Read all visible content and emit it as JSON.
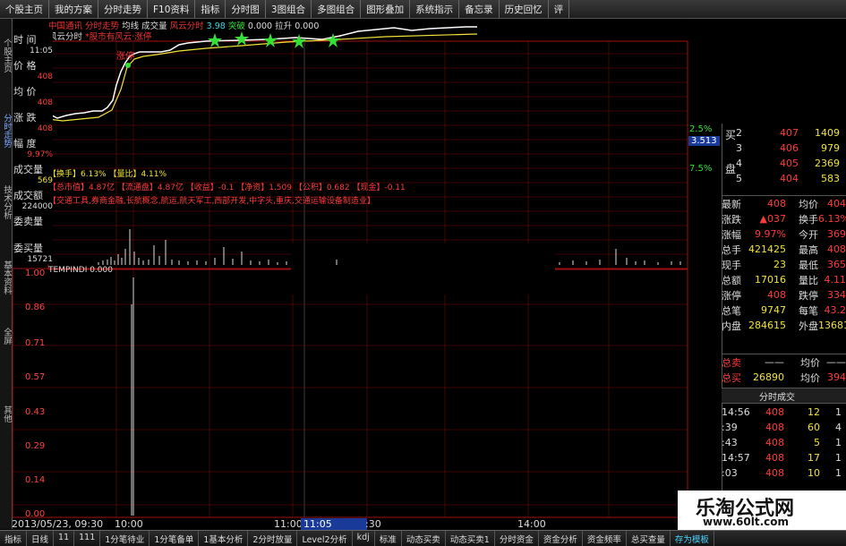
{
  "topbar": [
    "个股主页",
    "我的方案",
    "分时走势",
    "F10资料",
    "指标",
    "分时图",
    "3图组合",
    "多图组合",
    "图形叠加",
    "系统指示",
    "备忘录",
    "历史回忆",
    "评"
  ],
  "header": {
    "line1_a": "中国通讯 分时走势",
    "line1_b": "均线 成交量",
    "line1_c": "风云分时",
    "line1_d": "3.98",
    "line1_e": "突破",
    "line1_f": "0.000",
    "line1_g": "拉升",
    "line1_h": "0.000",
    "line2_a": "风云分时",
    "line2_b": "*股市有风云·涨停"
  },
  "left_table": {
    "row1": "时 间",
    "row1_v": "11:05",
    "row2": "价 格",
    "row2_v": "408",
    "row3": "均 价",
    "row3_v": "408",
    "row4": "涨 跌",
    "row4_v": "408",
    "row5": "幅 度",
    "row5_v": "9.97%",
    "row6": "成交量",
    "row6_v": "569",
    "row7": "成交额",
    "row7_v": "224000",
    "row8": "委卖量",
    "row8_v": "",
    "row9": "委买量",
    "row9_v": "15721"
  },
  "overlay": {
    "a": "【换手】6.13% 【量比】4.11%",
    "b": "【总市值】4.87亿 【流通盘】4.87亿 【收益】-0.1 【净资】1.509 【公积】0.682 【现金】-0.11",
    "c": "【交通工具,券商金融,长航概念,航运,航天军工,西部开发,中字头,重庆,交通运输设备制造业】"
  },
  "lower_panel_title": "TEMPINDI 0.000",
  "lower_y_labels": [
    "1.00",
    "0.86",
    "0.71",
    "0.57",
    "0.43",
    "0.29",
    "0.14",
    "0.00"
  ],
  "time_labels": {
    "start": "2013/05/23, 09:30",
    "t1000": "10:00",
    "t1100": "11:00",
    "cursor": "11:05",
    "t1130": ":30",
    "t1400": "14:00"
  },
  "right_panel": {
    "pct1": "2.5%",
    "price_cursor": "3.513",
    "pct2": "7.5%",
    "buy_label": "买",
    "sell_label": "盘",
    "bids": [
      {
        "lvl": "2",
        "price": "407",
        "vol": "1409"
      },
      {
        "lvl": "3",
        "price": "406",
        "vol": "979"
      },
      {
        "lvl": "4",
        "price": "405",
        "vol": "2369"
      },
      {
        "lvl": "5",
        "price": "404",
        "vol": "583"
      }
    ],
    "stats": [
      {
        "l": "最新",
        "v": "408",
        "l2": "均价",
        "v2": "404"
      },
      {
        "l": "涨跌",
        "v": "▲037",
        "l2": "换手",
        "v2": "6.13%"
      },
      {
        "l": "涨幅",
        "v": "9.97%",
        "l2": "今开",
        "v2": "369"
      },
      {
        "l": "总手",
        "v": "421425",
        "l2": "最高",
        "v2": "408"
      },
      {
        "l": "现手",
        "v": "23",
        "l2": "最低",
        "v2": "365"
      },
      {
        "l": "总额",
        "v": "17016",
        "l2": "量比",
        "v2": "4.11"
      },
      {
        "l": "涨停",
        "v": "408",
        "l2": "跌停",
        "v2": "334"
      },
      {
        "l": "总笔",
        "v": "9747",
        "l2": "每笔",
        "v2": "43.2"
      },
      {
        "l": "内盘",
        "v": "284615",
        "l2": "外盘",
        "v2": "13681"
      }
    ],
    "sell_total_label": "总卖",
    "sell_total_v": "——",
    "sell_total_avg": "均价",
    "sell_total_avgv": "——",
    "buy_total_label": "总买",
    "buy_total_v": "26890",
    "buy_total_avg": "均价",
    "buy_total_avgv": "394",
    "ticks_header": "分时成交",
    "ticks": [
      {
        "t": "14:56",
        "p": "408",
        "v": "12",
        "f": "1"
      },
      {
        "t": ":39",
        "p": "408",
        "v": "60",
        "f": "4"
      },
      {
        "t": ":43",
        "p": "408",
        "v": "5",
        "f": "1"
      },
      {
        "t": "14:57",
        "p": "408",
        "v": "17",
        "f": "1"
      },
      {
        "t": ":03",
        "p": "408",
        "v": "10",
        "f": "1"
      }
    ]
  },
  "bottombar": [
    "指标",
    "日线",
    "11",
    "111",
    "1分笔待业",
    "1分笔备单",
    "1基本分析",
    "2分时放量",
    "Level2分析",
    "kdj",
    "标准",
    "动态买卖",
    "动态买卖1",
    "分时资金",
    "资金分析",
    "资金频率",
    "总买查量",
    "存为模板"
  ],
  "bottombar_active": "存为模板",
  "watermark": {
    "name": "乐淘公式网",
    "url": "www.60lt.com"
  },
  "colors": {
    "grid": "#a01010",
    "up": "#ff3b3b",
    "down": "#35e035",
    "price_line": "#ffffff",
    "avg_line": "#f2e23a"
  }
}
